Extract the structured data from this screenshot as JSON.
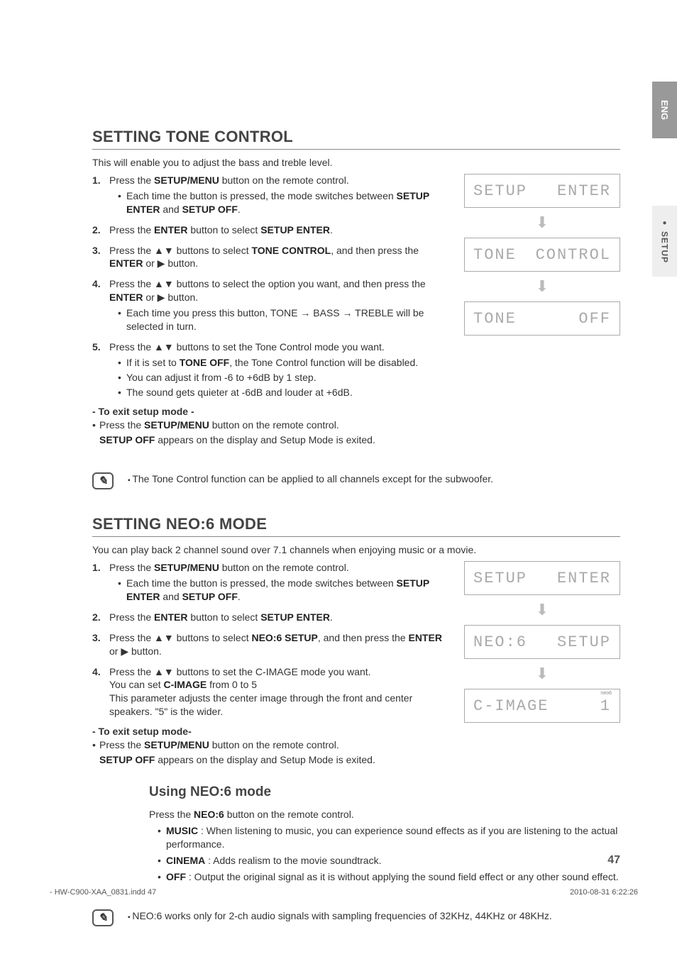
{
  "lang_tab": "ENG",
  "section_tab": "SETUP",
  "tone": {
    "title": "SETTING TONE CONTROL",
    "intro": "This will enable you to adjust the bass and treble level.",
    "steps": {
      "s1_a": "Press the ",
      "s1_b": "SETUP/MENU",
      "s1_c": " button on the remote control.",
      "s1_sub_a": "Each time the button is pressed, the mode switches between ",
      "s1_sub_b": "SETUP ENTER",
      "s1_sub_c": " and ",
      "s1_sub_d": "SETUP OFF",
      "s1_sub_e": ".",
      "s2_a": "Press the ",
      "s2_b": "ENTER",
      "s2_c": " button to select ",
      "s2_d": "SETUP ENTER",
      "s2_e": ".",
      "s3_a": "Press the ▲▼ buttons to select ",
      "s3_b": "TONE CONTROL",
      "s3_c": ", and then press the ",
      "s3_d": "ENTER",
      "s3_e": " or ▶ button.",
      "s4_a": "Press the ▲▼ buttons to select the option you want, and then press the ",
      "s4_b": "ENTER",
      "s4_c": " or ▶ button.",
      "s4_sub": "Each time you press this button, TONE → BASS → TREBLE will be selected in turn.",
      "s5": "Press the ▲▼ buttons to set the Tone Control mode you want.",
      "s5_sub1_a": "If it is set to ",
      "s5_sub1_b": "TONE OFF",
      "s5_sub1_c": ", the Tone Control function will be disabled.",
      "s5_sub2": "You can adjust it from -6 to +6dB by 1 step.",
      "s5_sub3": "The sound gets quieter at -6dB and louder at +6dB."
    },
    "exit": {
      "head": "- To exit setup mode -",
      "l1_a": "Press the ",
      "l1_b": "SETUP/MENU",
      "l1_c": " button on the remote control.",
      "l2_a": "SETUP OFF",
      "l2_b": " appears on the display and Setup Mode is exited."
    },
    "lcd": {
      "d1_l": "SETUP",
      "d1_r": "ENTER",
      "d2_l": "TONE",
      "d2_r": "CONTROL",
      "d3_l": "TONE",
      "d3_r": "OFF"
    },
    "note": "The Tone Control function can be applied to all channels except for the subwoofer."
  },
  "neo6": {
    "title": "SETTING NEO:6 MODE",
    "intro": "You can play back 2 channel sound over 7.1 channels when enjoying music or a movie.",
    "steps": {
      "s1_a": "Press the ",
      "s1_b": "SETUP/MENU",
      "s1_c": " button on the remote control.",
      "s1_sub_a": "Each time the button is pressed, the mode switches between ",
      "s1_sub_b": "SETUP ENTER",
      "s1_sub_c": " and ",
      "s1_sub_d": "SETUP OFF",
      "s1_sub_e": ".",
      "s2_a": "Press the ",
      "s2_b": "ENTER",
      "s2_c": " button to select ",
      "s2_d": "SETUP ENTER",
      "s2_e": ".",
      "s3_a": "Press the ▲▼ buttons to select ",
      "s3_b": "NEO:6 SETUP",
      "s3_c": ", and then press the ",
      "s3_d": "ENTER",
      "s3_e": " or ▶ button.",
      "s4_a": "Press the ▲▼ buttons to set the C-IMAGE mode you want.",
      "s4_l2_a": "You can set ",
      "s4_l2_b": "C-IMAGE",
      "s4_l2_c": " from 0 to 5",
      "s4_l3": "This parameter adjusts the center image through the front and center speakers. \"5\" is the wider."
    },
    "exit": {
      "head": "- To exit setup mode-",
      "l1_a": "Press the ",
      "l1_b": "SETUP/MENU",
      "l1_c": " button on the remote control.",
      "l2_a": "SETUP OFF",
      "l2_b": " appears on the display and Setup Mode is exited."
    },
    "lcd": {
      "d1_l": "SETUP",
      "d1_r": "ENTER",
      "d2_l": "NEO:6",
      "d2_r": "SETUP",
      "d3_l": "C-IMAGE",
      "d3_r": "1",
      "d3_label": "neo6"
    },
    "using": {
      "title": "Using NEO:6 mode",
      "intro_a": "Press the ",
      "intro_b": "NEO:6",
      "intro_c": " button on the remote control.",
      "m1_a": "MUSIC",
      "m1_b": "  : When listening to music, you can experience sound effects as if you are listening to the actual performance.",
      "m2_a": "CINEMA",
      "m2_b": "  : Adds realism to the movie soundtrack.",
      "m3_a": "OFF",
      "m3_b": "  : Output the original signal as it is without applying the sound field effect or any other sound effect."
    },
    "note": "NEO:6 works only for 2-ch audio signals with sampling frequencies of 32KHz, 44KHz or 48KHz."
  },
  "page_number": "47",
  "footer_left": "- HW-C900-XAA_0831.indd   47",
  "footer_right": "2010-08-31    6:22:26"
}
